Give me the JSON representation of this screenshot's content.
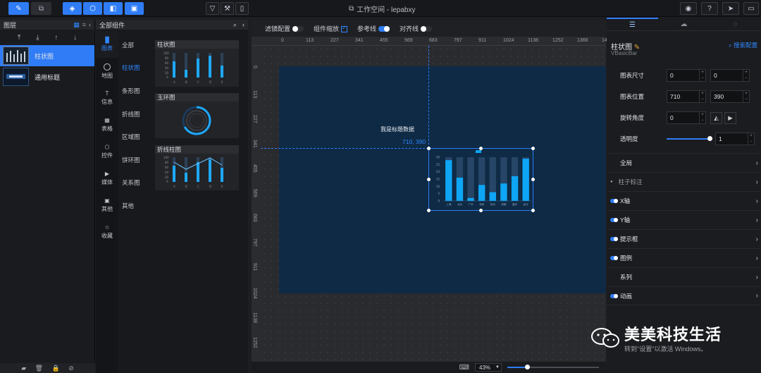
{
  "topbar": {
    "workspace": "工作空间 - lepabxy"
  },
  "layers": {
    "header": "图层",
    "items": [
      {
        "label": "柱状图",
        "selected": true
      },
      {
        "label": "通用标题",
        "selected": false
      }
    ]
  },
  "components": {
    "header": "全部组件",
    "categories": [
      "图表",
      "地图",
      "信息",
      "表格",
      "控件",
      "媒体",
      "其他",
      "收藏"
    ],
    "subcats": [
      "全部",
      "柱状图",
      "条形图",
      "折线图",
      "区域图",
      "饼环图",
      "关系图",
      "其他"
    ],
    "cards": [
      "柱状图",
      "玉环图",
      "折线柱图"
    ],
    "mini_ticks": [
      "100",
      "80",
      "60",
      "40",
      "20",
      "0"
    ],
    "mini_cats": [
      "A",
      "B",
      "C",
      "D",
      "E"
    ]
  },
  "canvas": {
    "toolbar": {
      "filter": "滤镜配置",
      "zoom_comp": "组件缩放",
      "guide": "参考线",
      "align": "对齐线"
    },
    "ruler_h": [
      "0",
      "113",
      "227",
      "341",
      "455",
      "569",
      "683",
      "797",
      "911",
      "1024",
      "1138",
      "1252",
      "1366",
      "1480"
    ],
    "ruler_v": [
      "0",
      "113",
      "227",
      "341",
      "455",
      "569",
      "683",
      "797",
      "911",
      "1024",
      "1138",
      "1252"
    ],
    "stage_title": "我是标题数据",
    "position_label": "710, 390",
    "zoom": "43%"
  },
  "chart_data": {
    "type": "bar",
    "categories": [
      "上海",
      "北京",
      "广州",
      "深圳",
      "杭州",
      "成都",
      "重庆",
      "武汉"
    ],
    "values": [
      28,
      16,
      2,
      11,
      6,
      12,
      17,
      29
    ],
    "background_values": [
      30,
      30,
      30,
      30,
      30,
      30,
      30,
      30
    ],
    "ylim": [
      0,
      30
    ],
    "yticks": [
      "30",
      "25",
      "20",
      "15",
      "10",
      "5",
      "0"
    ],
    "colors": {
      "bar": "#0ea5f5",
      "track": "#274566"
    }
  },
  "props": {
    "title": "柱状图",
    "subtitle": "VBasicBar",
    "search": "搜索配置",
    "size_label": "图表尺寸",
    "size_w": "0",
    "size_h": "0",
    "pos_label": "图表位置",
    "pos_x": "710",
    "pos_y": "390",
    "rot_label": "旋转角度",
    "rot": "0",
    "opacity_label": "透明度",
    "opacity": "1",
    "opacity_level": 1,
    "sections": [
      "全局",
      "柱子标注",
      "X轴",
      "Y轴",
      "提示框",
      "图例",
      "系列",
      "动画"
    ]
  },
  "watermark": {
    "name": "美美科技生活",
    "sub": "转到\"设置\"以激活 Windows。"
  }
}
